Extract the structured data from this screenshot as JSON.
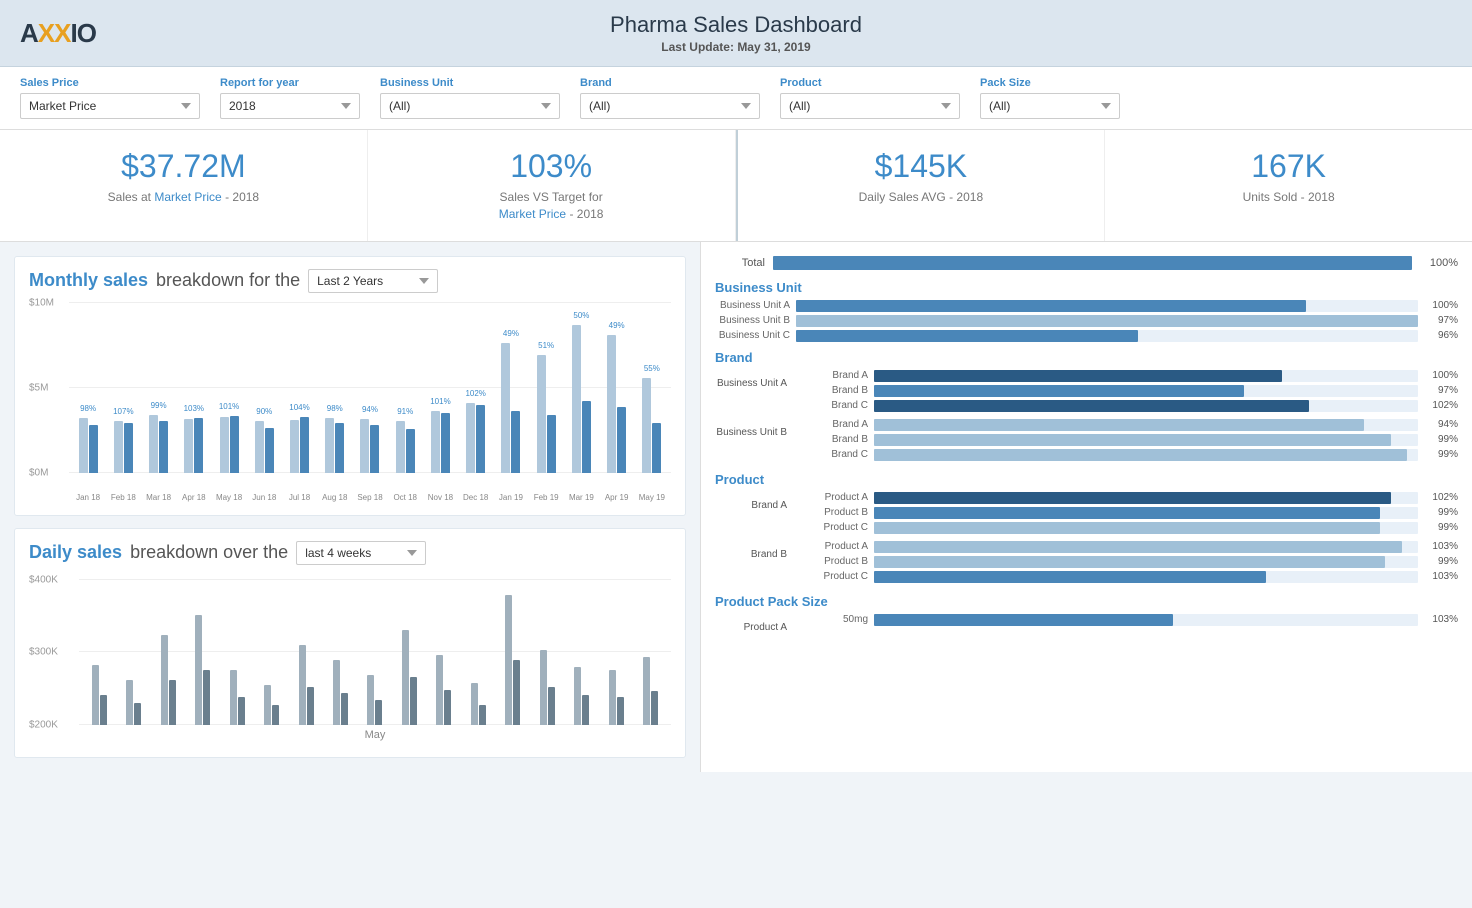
{
  "header": {
    "title": "Pharma Sales Dashboard",
    "subtitle_prefix": "Last Update:",
    "subtitle_date": "May 31, 2019",
    "logo": "AXXIO"
  },
  "filters": {
    "sales_price_label": "Sales Price",
    "sales_price_value": "Market Price",
    "report_year_label": "Report for year",
    "report_year_value": "2018",
    "business_unit_label": "Business Unit",
    "business_unit_value": "(All)",
    "brand_label": "Brand",
    "brand_value": "(All)",
    "product_label": "Product",
    "product_value": "(All)",
    "pack_size_label": "Pack Size",
    "pack_size_value": "(All)"
  },
  "kpis": {
    "sales_value": "$37.72M",
    "sales_label_1": "Sales at",
    "sales_label_2": "Market Price",
    "sales_label_3": "- 2018",
    "target_value": "103%",
    "target_label_1": "Sales VS Target for",
    "target_label_2": "Market Price",
    "target_label_3": "- 2018",
    "daily_avg_value": "$145K",
    "daily_avg_label": "Daily Sales AVG - 2018",
    "units_sold_value": "167K",
    "units_sold_label": "Units Sold  - 2018"
  },
  "monthly_chart": {
    "title_accent": "Monthly sales",
    "title_rest": "breakdown for the",
    "dropdown_value": "Last 2 Years",
    "y_labels": [
      "$10M",
      "$5M",
      "$0M"
    ],
    "bars": [
      {
        "label": "Jan 18",
        "pct": "98%",
        "prev_h": 55,
        "curr_h": 48
      },
      {
        "label": "Feb 18",
        "pct": "107%",
        "prev_h": 52,
        "curr_h": 50
      },
      {
        "label": "Mar 18",
        "pct": "99%",
        "prev_h": 58,
        "curr_h": 52
      },
      {
        "label": "Apr 18",
        "pct": "103%",
        "prev_h": 54,
        "curr_h": 55
      },
      {
        "label": "May 18",
        "pct": "101%",
        "prev_h": 56,
        "curr_h": 57
      },
      {
        "label": "Jun 18",
        "pct": "90%",
        "prev_h": 52,
        "curr_h": 45
      },
      {
        "label": "Jul 18",
        "pct": "104%",
        "prev_h": 53,
        "curr_h": 56
      },
      {
        "label": "Aug 18",
        "pct": "98%",
        "prev_h": 55,
        "curr_h": 50
      },
      {
        "label": "Sep 18",
        "pct": "94%",
        "prev_h": 54,
        "curr_h": 48
      },
      {
        "label": "Oct 18",
        "pct": "91%",
        "prev_h": 52,
        "curr_h": 44
      },
      {
        "label": "Nov 18",
        "pct": "101%",
        "prev_h": 62,
        "curr_h": 60
      },
      {
        "label": "Dec 18",
        "pct": "102%",
        "prev_h": 70,
        "curr_h": 68
      },
      {
        "label": "Jan 19",
        "pct": "49%",
        "prev_h": 130,
        "curr_h": 62
      },
      {
        "label": "Feb 19",
        "pct": "51%",
        "prev_h": 118,
        "curr_h": 58
      },
      {
        "label": "Mar 19",
        "pct": "50%",
        "prev_h": 148,
        "curr_h": 72
      },
      {
        "label": "Apr 19",
        "pct": "49%",
        "prev_h": 138,
        "curr_h": 66
      },
      {
        "label": "May 19",
        "pct": "55%",
        "prev_h": 95,
        "curr_h": 50
      }
    ]
  },
  "daily_chart": {
    "title_accent": "Daily sales",
    "title_rest": "breakdown over the",
    "dropdown_value": "last 4 weeks",
    "month_label": "May",
    "y_labels": [
      "$400K",
      "$300K",
      "$200K"
    ],
    "bars": [
      {
        "prev_h": 60,
        "curr_h": 30
      },
      {
        "prev_h": 45,
        "curr_h": 22
      },
      {
        "prev_h": 90,
        "curr_h": 45
      },
      {
        "prev_h": 110,
        "curr_h": 55
      },
      {
        "prev_h": 55,
        "curr_h": 28
      },
      {
        "prev_h": 40,
        "curr_h": 20
      },
      {
        "prev_h": 80,
        "curr_h": 38
      },
      {
        "prev_h": 65,
        "curr_h": 32
      },
      {
        "prev_h": 50,
        "curr_h": 25
      },
      {
        "prev_h": 95,
        "curr_h": 48
      },
      {
        "prev_h": 70,
        "curr_h": 35
      },
      {
        "prev_h": 42,
        "curr_h": 20
      },
      {
        "prev_h": 130,
        "curr_h": 65
      },
      {
        "prev_h": 75,
        "curr_h": 38
      },
      {
        "prev_h": 58,
        "curr_h": 30
      },
      {
        "prev_h": 55,
        "curr_h": 28
      },
      {
        "prev_h": 68,
        "curr_h": 34
      }
    ]
  },
  "right_panel": {
    "total_label": "Total",
    "total_pct": "100%",
    "total_fill": 100,
    "business_unit_title": "Business Unit",
    "business_units": [
      {
        "label": "Business Unit A",
        "pct": "100%",
        "fill": 82,
        "style": "med"
      },
      {
        "label": "Business Unit B",
        "pct": "97%",
        "fill": 100,
        "style": "light"
      },
      {
        "label": "Business Unit C",
        "pct": "96%",
        "fill": 55,
        "style": "med"
      }
    ],
    "brand_title": "Brand",
    "brands": [
      {
        "group": "Business Unit A",
        "items": [
          {
            "label": "Brand A",
            "pct": "100%",
            "fill": 75,
            "style": "dark"
          },
          {
            "label": "Brand B",
            "pct": "97%",
            "fill": 68,
            "style": "med"
          },
          {
            "label": "Brand C",
            "pct": "102%",
            "fill": 80,
            "style": "dark"
          }
        ]
      },
      {
        "group": "Business Unit B",
        "items": [
          {
            "label": "Brand A",
            "pct": "94%",
            "fill": 90,
            "style": "light"
          },
          {
            "label": "Brand B",
            "pct": "99%",
            "fill": 95,
            "style": "light"
          },
          {
            "label": "Brand C",
            "pct": "99%",
            "fill": 98,
            "style": "light"
          }
        ]
      }
    ],
    "product_title": "Product",
    "products": [
      {
        "group": "Brand A",
        "items": [
          {
            "label": "Product A",
            "pct": "102%",
            "fill": 95,
            "style": "dark"
          },
          {
            "label": "Product B",
            "pct": "99%",
            "fill": 93,
            "style": "med"
          },
          {
            "label": "Product C",
            "pct": "99%",
            "fill": 93,
            "style": "light"
          }
        ]
      },
      {
        "group": "Brand B",
        "items": [
          {
            "label": "Product A",
            "pct": "103%",
            "fill": 97,
            "style": "light"
          },
          {
            "label": "Product B",
            "pct": "99%",
            "fill": 94,
            "style": "light"
          },
          {
            "label": "Product C",
            "pct": "103%",
            "fill": 72,
            "style": "med"
          }
        ]
      }
    ],
    "pack_size_title": "Product Pack Size",
    "pack_sizes": [
      {
        "group": "Product A",
        "items": [
          {
            "label": "50mg",
            "pct": "103%",
            "fill": 55,
            "style": "med"
          }
        ]
      }
    ]
  }
}
